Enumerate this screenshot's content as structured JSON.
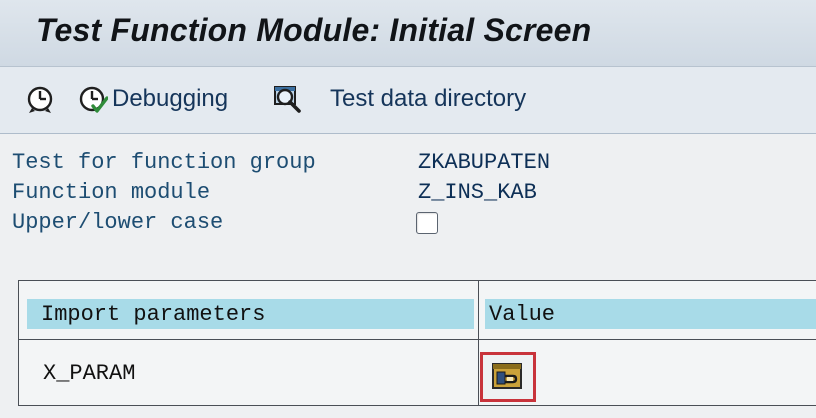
{
  "window": {
    "title": "Test Function Module: Initial Screen"
  },
  "toolbar": {
    "execute_icon": "clock-execute-icon",
    "debugging_label": "Debugging",
    "debugging_icon": "clock-check-icon",
    "test_data_label": "Test data directory",
    "test_data_icon": "magnifier-screen-icon"
  },
  "form": {
    "function_group_label": "Test for function group",
    "function_group_value": "ZKABUPATEN",
    "function_module_label": "Function module",
    "function_module_value": "Z_INS_KAB",
    "case_label": "Upper/lower case",
    "case_checked": false
  },
  "params": {
    "header_import": "Import parameters",
    "header_value": "Value",
    "rows": [
      {
        "name": "X_PARAM",
        "value_icon": "structure-edit-icon"
      }
    ]
  },
  "colors": {
    "header_fill": "#a8dbe8",
    "label_text": "#1d4d72",
    "highlight_border": "#c8333b"
  }
}
